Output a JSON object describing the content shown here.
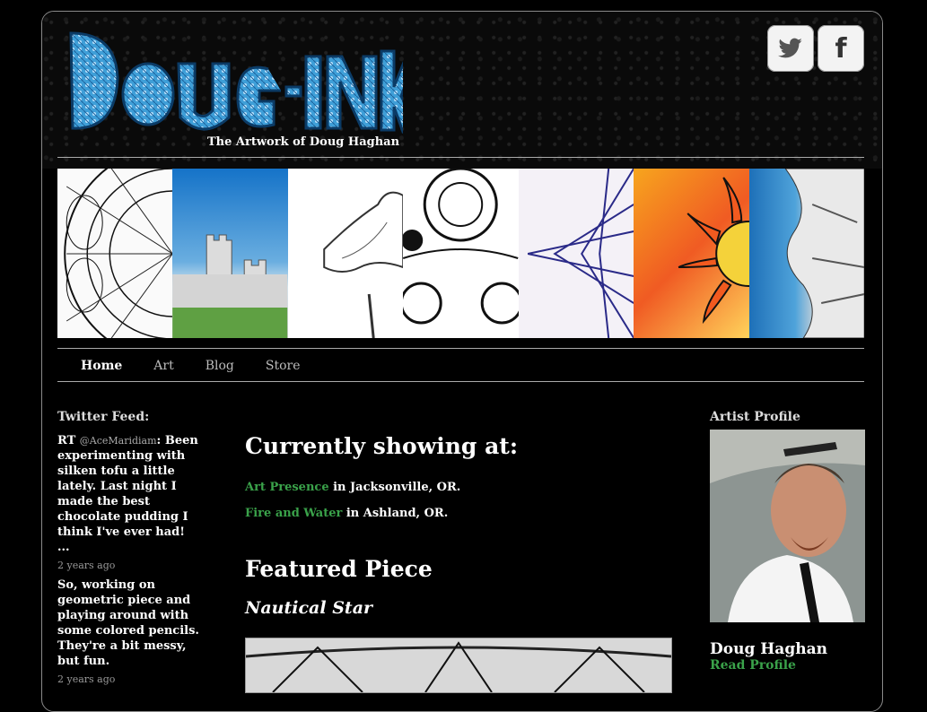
{
  "header": {
    "tagline": "The Artwork of Doug Haghan",
    "logo_text": "DOUG INK",
    "social": [
      {
        "name": "twitter-icon"
      },
      {
        "name": "facebook-icon",
        "glyph": "f"
      }
    ]
  },
  "nav": {
    "items": [
      {
        "label": "Home",
        "active": true
      },
      {
        "label": "Art"
      },
      {
        "label": "Blog"
      },
      {
        "label": "Store"
      }
    ]
  },
  "twitter": {
    "title": "Twitter Feed:",
    "tweets": [
      {
        "prefix": "RT",
        "handle": "@AceMaridiam",
        "text": ": Been experimenting with silken tofu a little lately. Last night I made the best chocolate pudding I think I've ever had! ...",
        "time": "2 years ago"
      },
      {
        "text": "So, working on geometric piece and playing around with some colored pencils. They're a bit messy, but fun.",
        "time": "2 years ago"
      }
    ]
  },
  "main": {
    "showing_title": "Currently showing at:",
    "showings": [
      {
        "venue": "Art Presence",
        "location": " in Jacksonville, OR."
      },
      {
        "venue": "Fire and Water",
        "location": " in Ashland, OR."
      }
    ],
    "featured_title": "Featured Piece",
    "featured_name": "Nautical Star"
  },
  "profile": {
    "title": "Artist Profile",
    "name": "Doug Haghan",
    "link": "Read Profile"
  },
  "colors": {
    "link_green": "#3aa24a",
    "logo_blue": "#3f9fd8"
  }
}
